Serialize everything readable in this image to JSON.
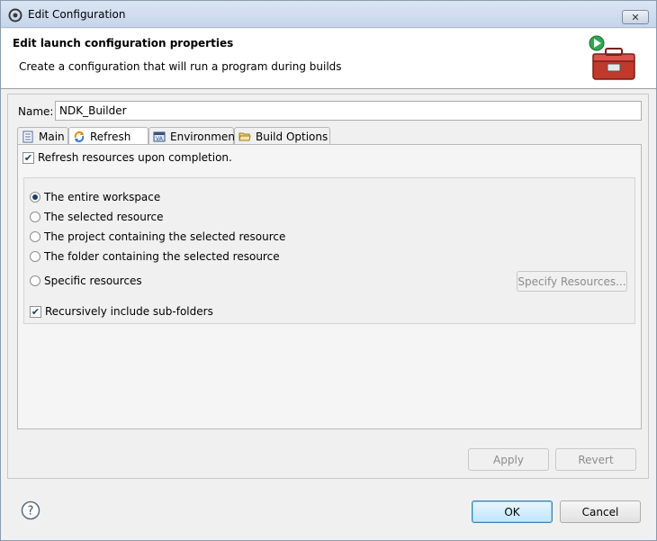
{
  "window": {
    "title": "Edit Configuration",
    "close_glyph": "✕"
  },
  "banner": {
    "title": "Edit launch configuration properties",
    "description": "Create a configuration that will run a program during builds"
  },
  "name_field": {
    "label": "Name:",
    "value": "NDK_Builder"
  },
  "tabs": [
    {
      "label": "Main",
      "icon": "document-icon",
      "active": false
    },
    {
      "label": "Refresh",
      "icon": "refresh-icon",
      "active": true
    },
    {
      "label": "Environment",
      "icon": "environment-icon",
      "active": false
    },
    {
      "label": "Build Options",
      "icon": "folder-open-icon",
      "active": false
    }
  ],
  "refresh_tab": {
    "refresh_on_completion": {
      "label": "Refresh resources upon completion.",
      "checked": true
    },
    "scope_options": [
      {
        "label": "The entire workspace",
        "selected": true
      },
      {
        "label": "The selected resource",
        "selected": false
      },
      {
        "label": "The project containing the selected resource",
        "selected": false
      },
      {
        "label": "The folder containing the selected resource",
        "selected": false
      },
      {
        "label": "Specific resources",
        "selected": false
      }
    ],
    "specify_resources_button": "Specify Resources...",
    "recursive": {
      "label": "Recursively include sub-folders",
      "checked": true
    }
  },
  "buttons": {
    "apply": "Apply",
    "revert": "Revert",
    "ok": "OK",
    "cancel": "Cancel"
  },
  "colors": {
    "title_bar": "#c6d5ea",
    "default_button_border": "#3c7fb1"
  }
}
